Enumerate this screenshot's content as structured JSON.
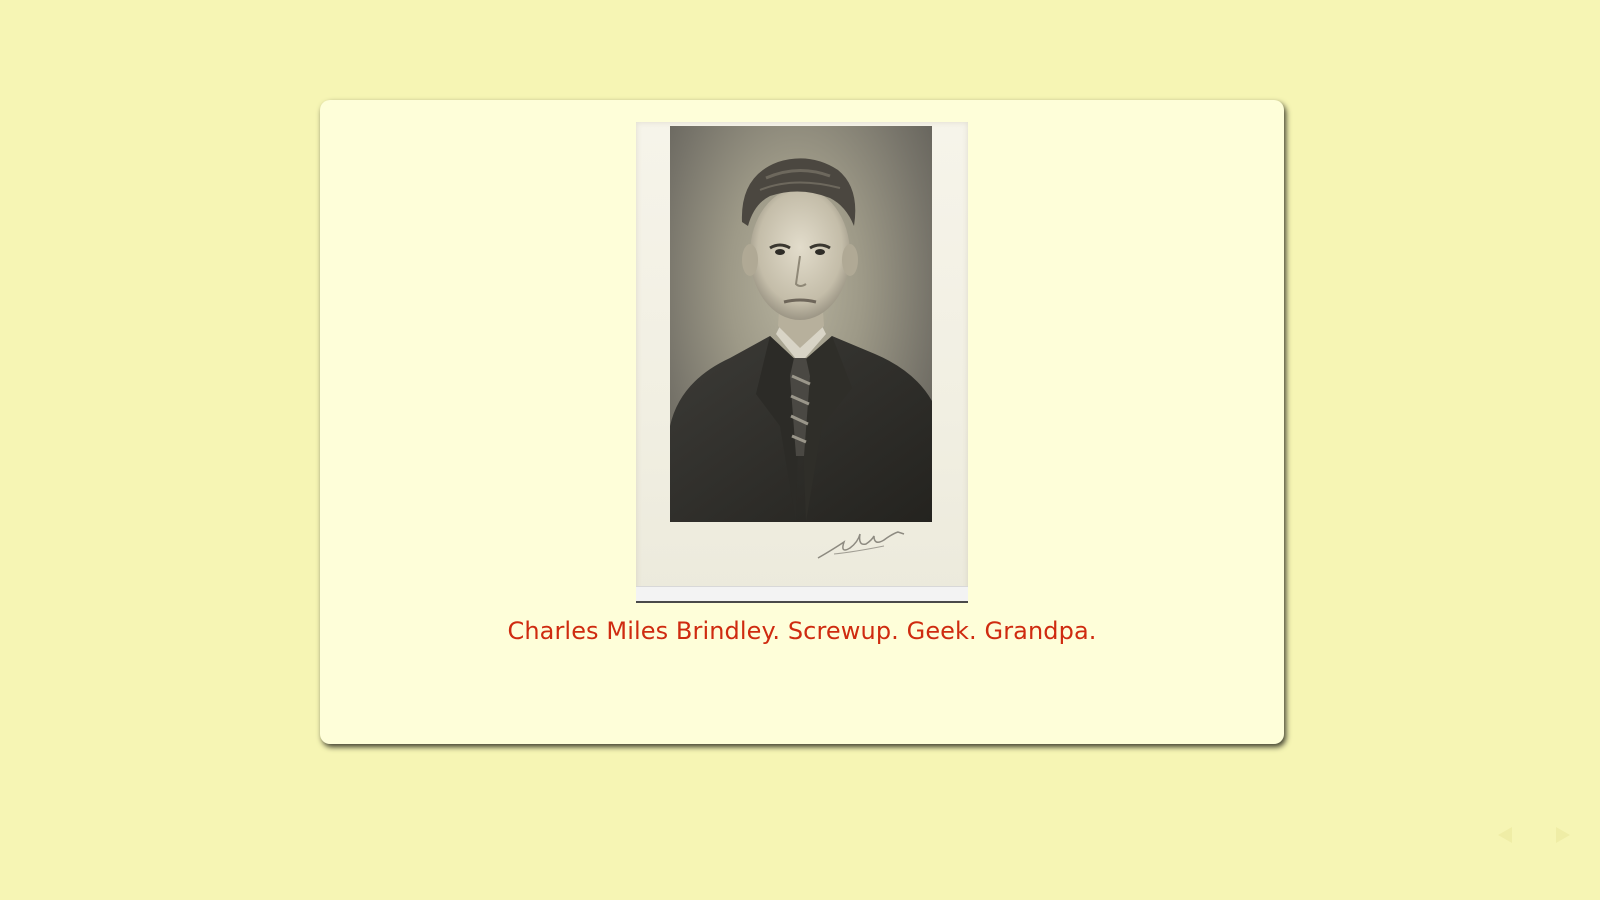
{
  "slide": {
    "caption": "Charles Miles Brindley. Screwup. Geek. Grandpa.",
    "photo_subject": "Charles Miles Brindley"
  },
  "navigation": {
    "previous_icon": "arrow-left-icon",
    "next_icon": "arrow-right-icon"
  },
  "colors": {
    "page_background": "#f6f5b4",
    "card_background": "#fefed9",
    "caption_text": "#cf2b10"
  }
}
